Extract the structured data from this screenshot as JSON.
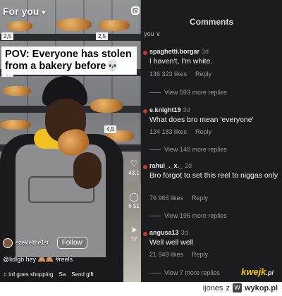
{
  "video": {
    "header_label": "For you",
    "caption": "POV: Everyone has stolen from a bakery before💀",
    "price_tags": [
      "2,5",
      "2,5",
      "2,5",
      "4,5"
    ],
    "action_counts": [
      "43,1",
      "6 51",
      "77"
    ],
    "username": "ezekielthe1st",
    "follow_label": "Follow",
    "description": "@lidlgb hey 🙈🙈 #reels",
    "audio": "♫ ird goes shopping",
    "audio_extra": "Sa",
    "send_gift": "Send gift"
  },
  "comments_panel": {
    "title": "Comments",
    "you_label": "you ∨",
    "reply_label": "Reply",
    "items": [
      {
        "user": "spaghetti.borgar",
        "time": "3d",
        "text": "I haven't, I'm white.",
        "likes": "136 323 likes",
        "more": "View 593 more replies"
      },
      {
        "user": "e.knight19",
        "time": "3d",
        "text": "What does bro mean 'everyone'",
        "likes": "124 183 likes",
        "more": "View 140 more replies"
      },
      {
        "user": "rahul_._x._",
        "time": "2d",
        "text": "Bro forgot to set this reel to niggas only",
        "likes": "76 966 likes",
        "more": "View 195 more replies"
      },
      {
        "user": "angusa13",
        "time": "3d",
        "text": "Well well well",
        "likes": "21 949 likes",
        "more": "View 7 more replies"
      }
    ],
    "watermark": "kwejk",
    "watermark_suffix": ".pl"
  },
  "footer": {
    "author": "ijones",
    "via": "z",
    "source": "wykop.pl"
  },
  "colors": {
    "panel_bg": "#1c1c1e",
    "watermark": "#f1c40f",
    "hoodie_yellow": "#f0c020"
  }
}
